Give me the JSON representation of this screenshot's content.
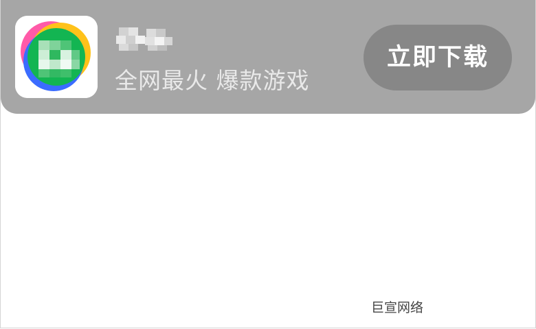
{
  "ad": {
    "app_name": "",
    "slogan": "全网最火 爆款游戏",
    "cta_label": "立即下载",
    "source_label": "巨宣网络",
    "icon": "app-logo-icon"
  },
  "colors": {
    "banner_bg": "#a6a6a6",
    "button_bg": "#878787",
    "button_text": "#ffffff",
    "slogan_text": "#e9e9e9",
    "source_text": "#444444",
    "icon_green": "#13b552"
  }
}
